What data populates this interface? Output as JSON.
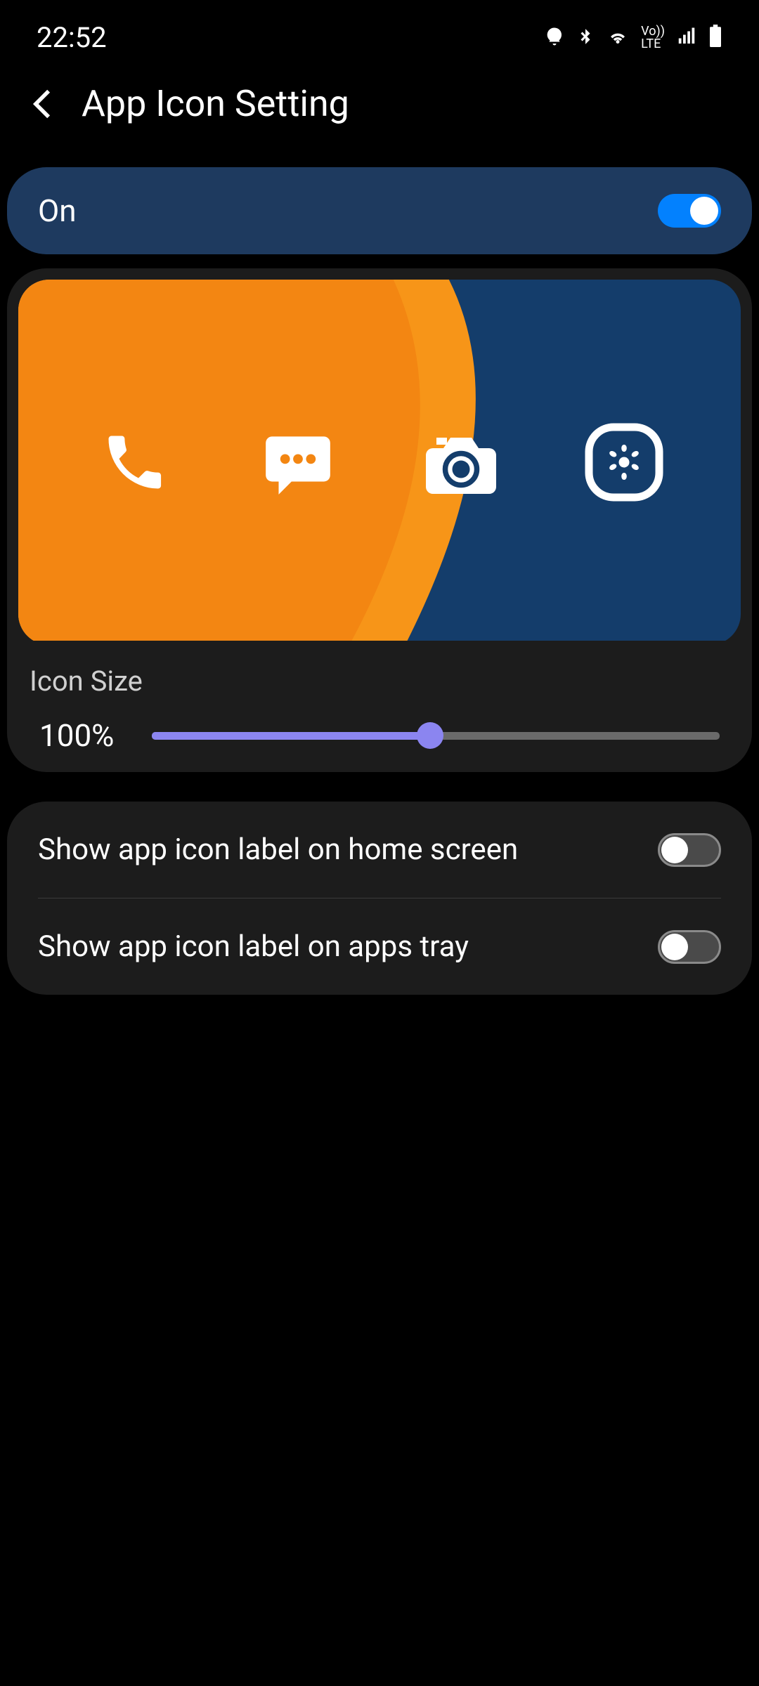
{
  "statusBar": {
    "time": "22:52"
  },
  "header": {
    "title": "App Icon Setting"
  },
  "mainToggle": {
    "label": "On",
    "state": true
  },
  "iconSize": {
    "label": "Icon Size",
    "value": "100%",
    "percent": 49
  },
  "settings": {
    "homeScreen": {
      "label": "Show app icon label on home screen",
      "state": false
    },
    "appsTray": {
      "label": "Show app icon label on apps tray",
      "state": false
    }
  },
  "previewIcons": [
    "phone",
    "messages",
    "camera",
    "gallery"
  ]
}
